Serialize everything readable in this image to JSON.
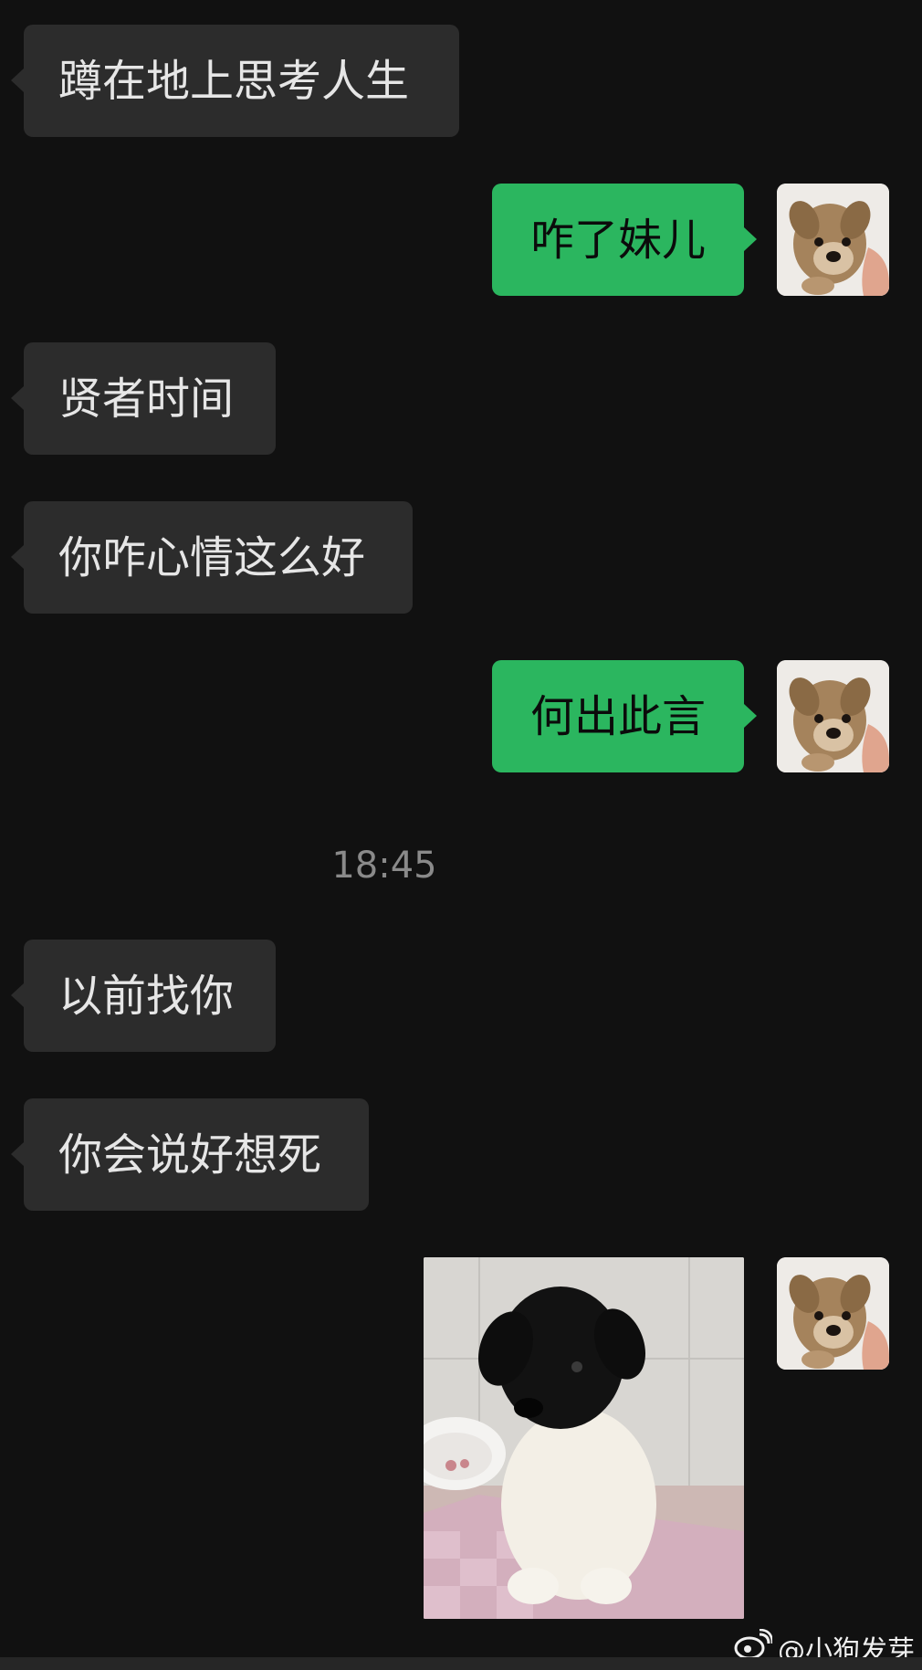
{
  "messages": [
    {
      "side": "in",
      "text": "蹲在地上思考人生"
    },
    {
      "side": "out",
      "text": "咋了妹儿"
    },
    {
      "side": "in",
      "text": "贤者时间"
    },
    {
      "side": "in",
      "text": "你咋心情这么好"
    },
    {
      "side": "out",
      "text": "何出此言"
    },
    {
      "side": "in",
      "text": "以前找你"
    },
    {
      "side": "in",
      "text": "你会说好想死"
    }
  ],
  "timestamp": "18:45",
  "watermark": {
    "icon": "weibo-icon",
    "text": "@小狗发芽"
  },
  "colors": {
    "background": "#111111",
    "incoming_bubble": "#2c2c2c",
    "outgoing_bubble": "#2bb65f"
  }
}
